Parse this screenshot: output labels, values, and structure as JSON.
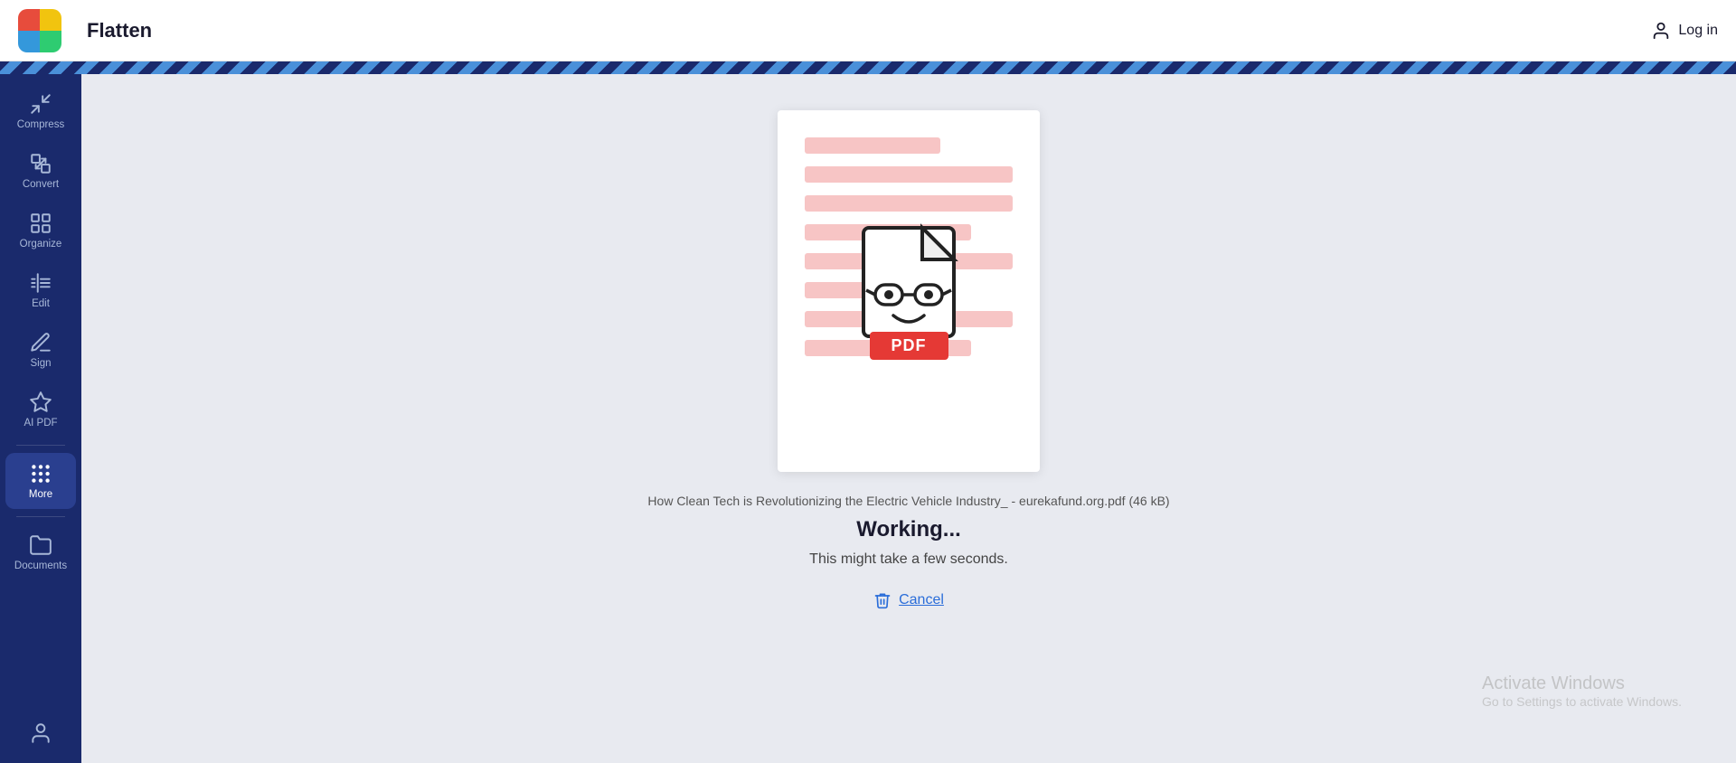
{
  "topbar": {
    "back_label": "↺",
    "title": "Flatten",
    "login_label": "Log in"
  },
  "sidebar": {
    "items": [
      {
        "id": "compress",
        "label": "Compress",
        "icon": "compress-icon",
        "active": false
      },
      {
        "id": "convert",
        "label": "Convert",
        "icon": "convert-icon",
        "active": false
      },
      {
        "id": "organize",
        "label": "Organize",
        "icon": "organize-icon",
        "active": false
      },
      {
        "id": "edit",
        "label": "Edit",
        "icon": "edit-icon",
        "active": false
      },
      {
        "id": "sign",
        "label": "Sign",
        "icon": "sign-icon",
        "active": false
      },
      {
        "id": "ai-pdf",
        "label": "AI PDF",
        "icon": "ai-icon",
        "active": false
      },
      {
        "id": "more",
        "label": "More",
        "icon": "more-icon",
        "active": true
      },
      {
        "id": "documents",
        "label": "Documents",
        "icon": "documents-icon",
        "active": false
      },
      {
        "id": "account",
        "label": "",
        "icon": "account-icon",
        "active": false
      }
    ]
  },
  "main": {
    "file_name": "How Clean Tech is Revolutionizing the Electric Vehicle Industry_ - eurekafund.org.pdf (46 kB)",
    "working_title": "Working...",
    "working_subtitle": "This might take a few seconds.",
    "cancel_label": "Cancel",
    "pdf_badge": "PDF"
  },
  "watermark": {
    "title": "Activate Windows",
    "subtitle": "Go to Settings to activate Windows."
  }
}
